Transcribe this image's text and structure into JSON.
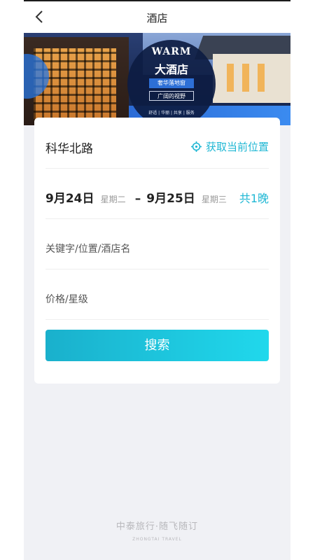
{
  "header": {
    "title": "酒店",
    "back_icon": "chevron-left-icon"
  },
  "banner": {
    "logo_en": "WARM",
    "logo_cn": "大酒店",
    "tag_primary": "奢华落地窗",
    "tag_secondary": "广阔的视野",
    "tagline": "舒适 | 华丽 | 共享 | 服务"
  },
  "search_form": {
    "location": "科华北路",
    "locate_label": "获取当前位置",
    "locate_icon": "crosshair-icon",
    "check_in_date": "9月24日",
    "check_in_weekday": "星期二",
    "separator": "–",
    "check_out_date": "9月25日",
    "check_out_weekday": "星期三",
    "nights": "共1晚",
    "keyword_placeholder": "关键字/位置/酒店名",
    "price_star_placeholder": "价格/星级",
    "search_label": "搜索"
  },
  "footer": {
    "brand_cn": "中泰旅行·随飞随订",
    "brand_en": "ZHONGTAI TRAVEL"
  },
  "colors": {
    "accent": "#1fb7d4",
    "background": "#f0f1f5"
  }
}
